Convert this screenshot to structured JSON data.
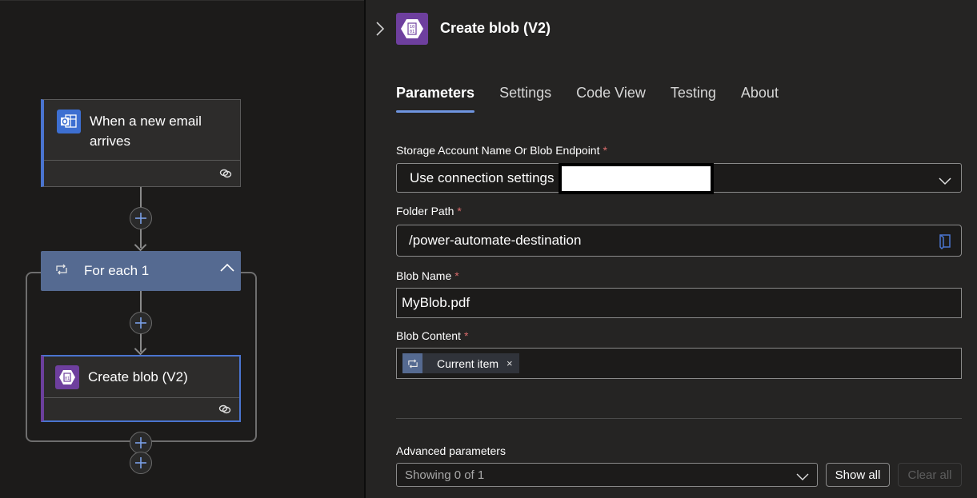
{
  "canvas": {
    "trigger": {
      "title": "When a new email arrives",
      "icon": "outlook-icon",
      "accent": "#4a74d0"
    },
    "foreach": {
      "title": "For each 1",
      "icon": "loop-icon",
      "color": "#556a91"
    },
    "action": {
      "title": "Create blob (V2)",
      "icon": "azure-blob-icon",
      "accent": "#6c3f9c"
    }
  },
  "panel": {
    "title": "Create blob (V2)",
    "icon": "azure-blob-icon",
    "tabs": [
      {
        "label": "Parameters",
        "active": true
      },
      {
        "label": "Settings",
        "active": false
      },
      {
        "label": "Code View",
        "active": false
      },
      {
        "label": "Testing",
        "active": false
      },
      {
        "label": "About",
        "active": false
      }
    ],
    "fields": {
      "storage": {
        "label": "Storage Account Name Or Blob Endpoint",
        "required": "*",
        "value": "Use connection settings",
        "redacted": true
      },
      "folder": {
        "label": "Folder Path",
        "required": "*",
        "value": "/power-automate-destination"
      },
      "blob_name": {
        "label": "Blob Name",
        "required": "*",
        "value": "MyBlob.pdf"
      },
      "blob_content": {
        "label": "Blob Content",
        "required": "*",
        "token": {
          "label": "Current item",
          "remove": "×",
          "icon": "loop-icon"
        }
      }
    },
    "advanced": {
      "label": "Advanced parameters",
      "select_value": "Showing 0 of 1",
      "show_all": "Show all",
      "clear_all": "Clear all"
    }
  },
  "colors": {
    "accent_blue": "#6f95e0",
    "required_red": "#d96b6b",
    "blob_purple": "#6e3f9e",
    "outlook_blue": "#3d6fd1"
  }
}
